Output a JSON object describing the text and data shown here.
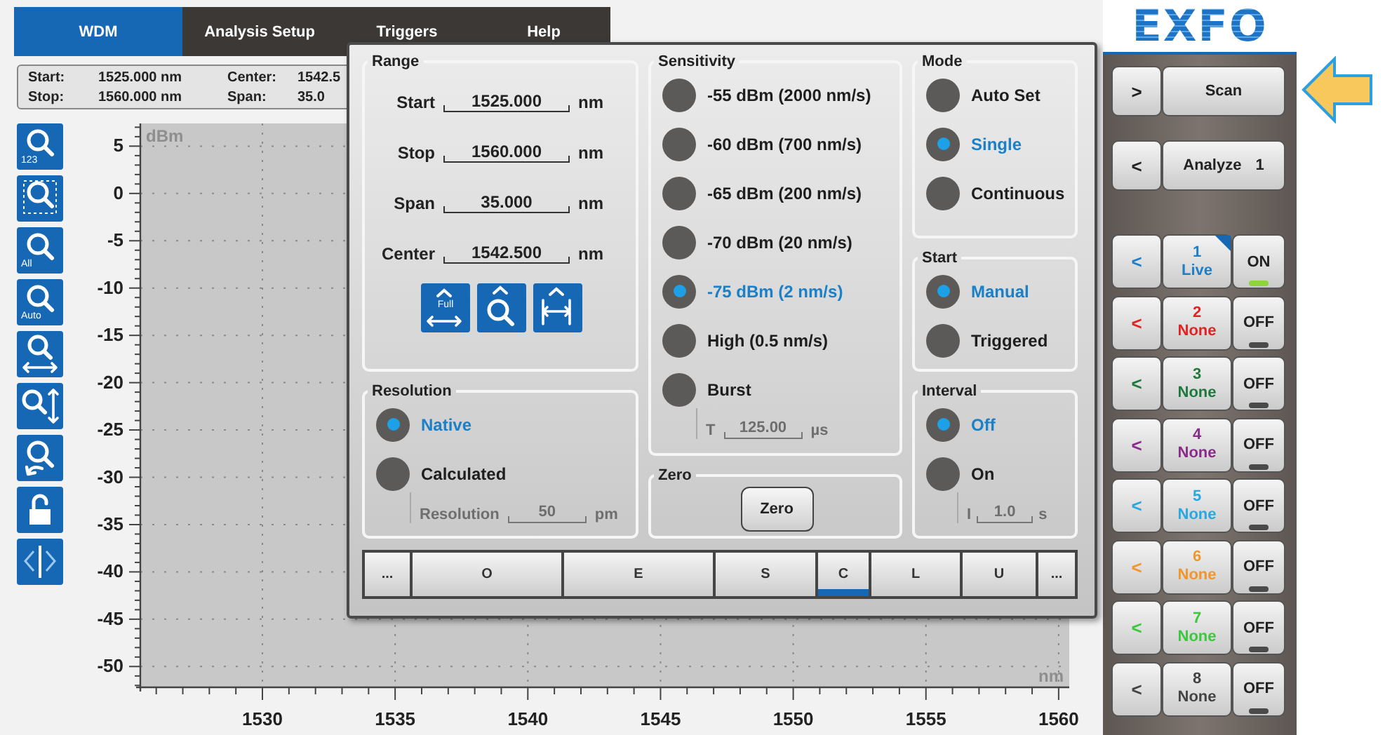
{
  "tabs": [
    {
      "label": "WDM",
      "selected": true
    },
    {
      "label": "Analysis Setup",
      "selected": false
    },
    {
      "label": "Triggers",
      "selected": false
    },
    {
      "label": "Help",
      "selected": false
    }
  ],
  "info_bar": [
    {
      "label": "Start:",
      "value": "1525.000 nm"
    },
    {
      "label": "Center:",
      "value": "1542.5"
    },
    {
      "label": "Stop:",
      "value": "1560.000 nm"
    },
    {
      "label": "Span:",
      "value": "35.0"
    }
  ],
  "toolbar": [
    {
      "kind": "zoom-number",
      "label": "123"
    },
    {
      "kind": "zoom-window"
    },
    {
      "kind": "zoom-all",
      "label": "All"
    },
    {
      "kind": "zoom-auto",
      "label": "Auto"
    },
    {
      "kind": "zoom-horizontal"
    },
    {
      "kind": "zoom-vertical"
    },
    {
      "kind": "zoom-undo"
    },
    {
      "kind": "lock"
    },
    {
      "kind": "marker"
    }
  ],
  "chart": {
    "chart_data": {
      "type": "line",
      "grid": true,
      "xlabel": "nm",
      "ylabel": "dBm",
      "xlim": [
        1525.4,
        1560.4
      ],
      "ylim": [
        -52.2,
        7.4
      ],
      "xticks": [
        1530,
        1535,
        1540,
        1545,
        1550,
        1555,
        1560
      ],
      "yticks": [
        5,
        0,
        -5,
        -10,
        -15,
        -20,
        -25,
        -30,
        -35,
        -40,
        -45,
        -50
      ]
    }
  },
  "dialog": {
    "columns": [
      {
        "groups": [
          {
            "kind": "fields",
            "title": "Range",
            "fields": [
              {
                "label": "Start",
                "value": "1525.000",
                "unit": "nm"
              },
              {
                "label": "Stop",
                "value": "1560.000",
                "unit": "nm"
              },
              {
                "label": "Span",
                "value": "35.000",
                "unit": "nm"
              },
              {
                "label": "Center",
                "value": "1542.500",
                "unit": "nm"
              }
            ],
            "buttons": [
              {
                "kind": "full",
                "label": "Full"
              },
              {
                "kind": "zoom"
              },
              {
                "kind": "span"
              }
            ]
          },
          {
            "kind": "options",
            "title": "Resolution",
            "options": [
              {
                "label": "Native",
                "selected": true
              },
              {
                "label": "Calculated",
                "selected": false
              }
            ],
            "field": {
              "label": "Resolution",
              "value": "50",
              "unit": "pm",
              "disabled": true
            }
          }
        ]
      },
      {
        "groups": [
          {
            "kind": "options",
            "title": "Sensitivity",
            "options": [
              {
                "label": "-55 dBm (2000 nm/s)",
                "selected": false
              },
              {
                "label": "-60 dBm (700 nm/s)",
                "selected": false
              },
              {
                "label": "-65 dBm (200 nm/s)",
                "selected": false
              },
              {
                "label": "-70 dBm (20 nm/s)",
                "selected": false
              },
              {
                "label": "-75 dBm (2 nm/s)",
                "selected": true
              },
              {
                "label": "High (0.5 nm/s)",
                "selected": false
              },
              {
                "label": "Burst",
                "selected": false
              }
            ],
            "field": {
              "label": "T",
              "value": "125.00",
              "unit": "µs",
              "disabled": true
            }
          },
          {
            "kind": "action",
            "title": "Zero",
            "button": "Zero"
          }
        ]
      },
      {
        "groups": [
          {
            "kind": "options",
            "title": "Mode",
            "options": [
              {
                "label": "Auto Set",
                "selected": false
              },
              {
                "label": "Single",
                "selected": true
              },
              {
                "label": "Continuous",
                "selected": false
              }
            ]
          },
          {
            "kind": "options",
            "title": "Start",
            "options": [
              {
                "label": "Manual",
                "selected": true
              },
              {
                "label": "Triggered",
                "selected": false
              }
            ]
          },
          {
            "kind": "options",
            "title": "Interval",
            "options": [
              {
                "label": "Off",
                "selected": true
              },
              {
                "label": "On",
                "selected": false
              }
            ],
            "field": {
              "label": "I",
              "value": "1.0",
              "unit": "s",
              "disabled": true
            }
          }
        ]
      }
    ],
    "bands": [
      {
        "label": "...",
        "selected": false
      },
      {
        "label": "O",
        "selected": false
      },
      {
        "label": "E",
        "selected": false
      },
      {
        "label": "S",
        "selected": false
      },
      {
        "label": "C",
        "selected": true
      },
      {
        "label": "L",
        "selected": false
      },
      {
        "label": "U",
        "selected": false
      },
      {
        "label": "...",
        "selected": false
      }
    ]
  },
  "logo": "EXFO",
  "side_buttons": [
    {
      "chevron": ">",
      "label": "Scan"
    },
    {
      "chevron": "<",
      "label": "Analyze",
      "count": "1"
    }
  ],
  "channels": [
    {
      "chevron": "<",
      "number": "1",
      "status": "Live",
      "state": "ON",
      "on": true,
      "selected": true,
      "color": "#1e7fc8"
    },
    {
      "chevron": "<",
      "number": "2",
      "status": "None",
      "state": "OFF",
      "on": false,
      "selected": false,
      "color": "#e02424"
    },
    {
      "chevron": "<",
      "number": "3",
      "status": "None",
      "state": "OFF",
      "on": false,
      "selected": false,
      "color": "#1e7a3c"
    },
    {
      "chevron": "<",
      "number": "4",
      "status": "None",
      "state": "OFF",
      "on": false,
      "selected": false,
      "color": "#8a2a8a"
    },
    {
      "chevron": "<",
      "number": "5",
      "status": "None",
      "state": "OFF",
      "on": false,
      "selected": false,
      "color": "#2aa7e0"
    },
    {
      "chevron": "<",
      "number": "6",
      "status": "None",
      "state": "OFF",
      "on": false,
      "selected": false,
      "color": "#f0962a"
    },
    {
      "chevron": "<",
      "number": "7",
      "status": "None",
      "state": "OFF",
      "on": false,
      "selected": false,
      "color": "#3cc83c"
    },
    {
      "chevron": "<",
      "number": "8",
      "status": "None",
      "state": "OFF",
      "on": false,
      "selected": false,
      "color": "#444444"
    }
  ]
}
